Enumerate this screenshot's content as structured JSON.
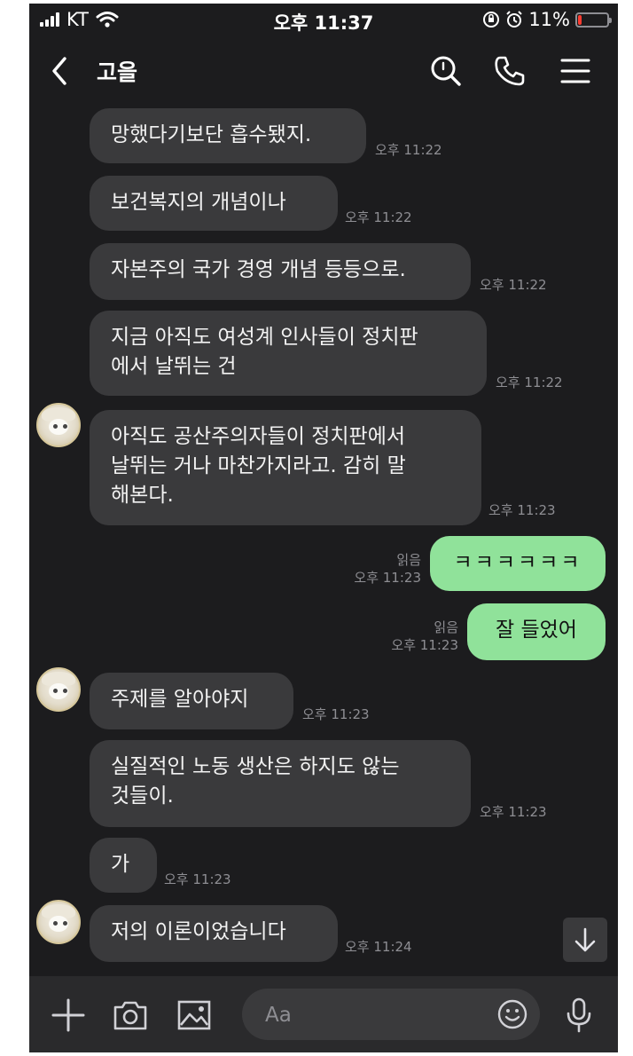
{
  "status_bar": {
    "carrier": "KT",
    "time": "오후 11:37",
    "battery": "11%",
    "battery_level": 0.11
  },
  "header": {
    "title": "고을"
  },
  "messages": [
    {
      "text": "망했다기보단 흡수됐지.",
      "time": "오후 11:22"
    },
    {
      "text": "보건복지의 개념이나",
      "time": "오후 11:22"
    },
    {
      "text": "자본주의 국가 경영 개념 등등으로.",
      "time": "오후 11:22"
    },
    {
      "text": "지금 아직도 여성계 인사들이 정치판\n에서 날뛰는 건",
      "time": "오후 11:22"
    },
    {
      "text": "아직도 공산주의자들이 정치판에서\n날뛰는 거나 마찬가지라고. 감히 말\n해본다.",
      "time": "오후 11:23"
    },
    {
      "text": "ㅋㅋㅋㅋㅋㅋ",
      "time": "오후 11:23",
      "read": "읽음"
    },
    {
      "text": "잘 들었어",
      "time": "오후 11:23",
      "read": "읽음"
    },
    {
      "text": "주제를 알아야지",
      "time": "오후 11:23"
    },
    {
      "text": "실질적인 노동 생산은 하지도 않는\n것들이.",
      "time": "오후 11:23"
    },
    {
      "text": "가",
      "time": "오후 11:23"
    },
    {
      "text": "저의 이론이었습니다",
      "time": "오후 11:24"
    }
  ],
  "input": {
    "placeholder": "Aa"
  },
  "icons": {
    "back": "chevron-left-icon",
    "search": "search-icon",
    "call": "phone-icon",
    "menu": "menu-icon",
    "plus": "plus-icon",
    "camera": "camera-icon",
    "gallery": "image-icon",
    "emoji": "smile-icon",
    "mic": "mic-icon",
    "scroll": "arrow-down-icon"
  },
  "colors": {
    "background": "#1c1c1e",
    "incoming_bubble": "#3a3a3c",
    "outgoing_bubble": "#90e29a",
    "meta_text": "#8e8e93"
  }
}
